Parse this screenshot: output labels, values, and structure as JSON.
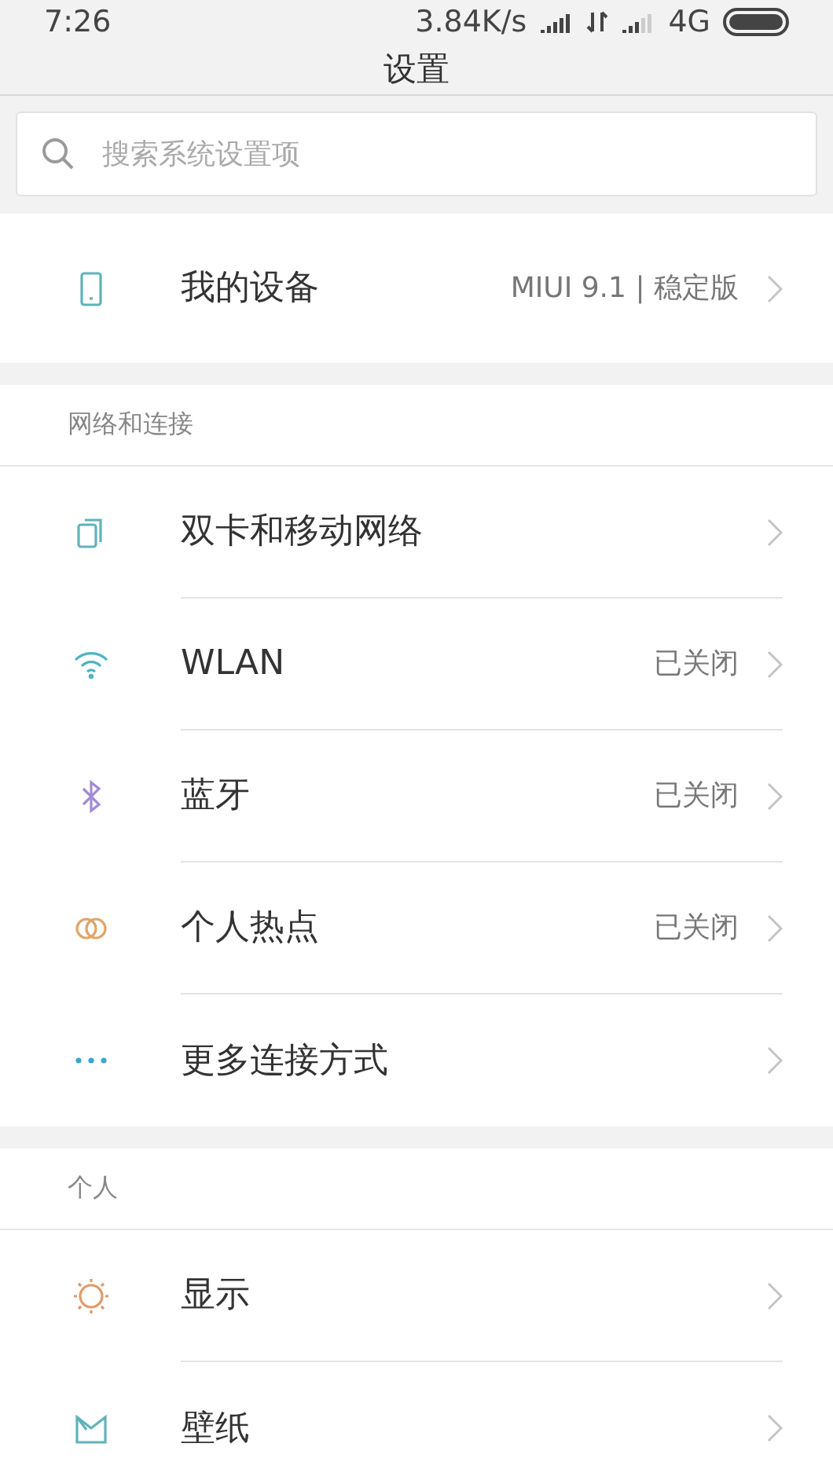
{
  "status_bar": {
    "time": "7:26",
    "speed": "3.84K/s",
    "network": "4G"
  },
  "title": "设置",
  "search": {
    "placeholder": "搜索系统设置项"
  },
  "sections": [
    {
      "items": [
        {
          "kind": "phone",
          "label": "我的设备",
          "value": "MIUI 9.1 | 稳定版"
        }
      ]
    },
    {
      "header": "网络和连接",
      "items": [
        {
          "kind": "sim",
          "label": "双卡和移动网络"
        },
        {
          "kind": "wifi",
          "label": "WLAN",
          "value": "已关闭"
        },
        {
          "kind": "bluetooth",
          "label": "蓝牙",
          "value": "已关闭"
        },
        {
          "kind": "hotspot",
          "label": "个人热点",
          "value": "已关闭"
        },
        {
          "kind": "dots",
          "label": "更多连接方式"
        }
      ]
    },
    {
      "header": "个人",
      "items": [
        {
          "kind": "sun",
          "label": "显示"
        },
        {
          "kind": "wallpaper",
          "label": "壁纸"
        }
      ]
    }
  ]
}
